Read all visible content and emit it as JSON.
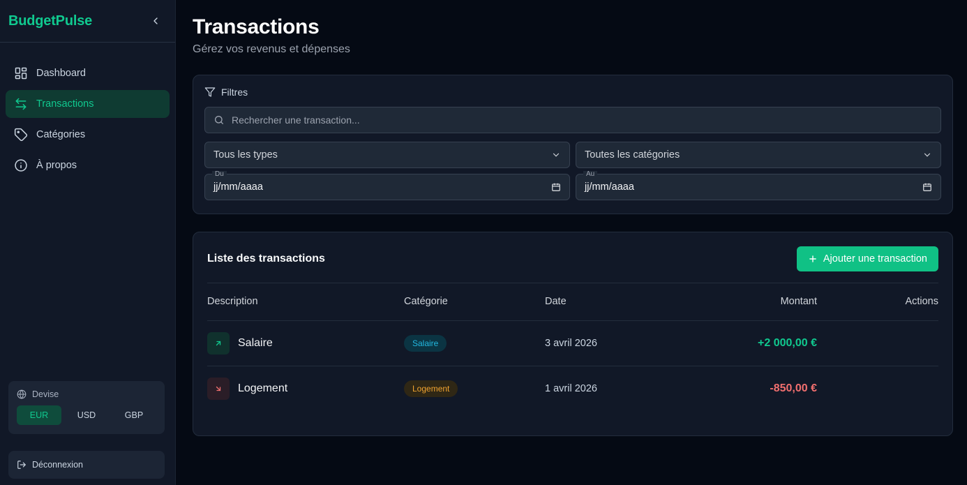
{
  "sidebar": {
    "brand": "BudgetPulse",
    "nav": [
      {
        "label": "Dashboard",
        "icon": "dashboard-grid-icon"
      },
      {
        "label": "Transactions",
        "icon": "arrows-swap-icon",
        "active": true
      },
      {
        "label": "Catégories",
        "icon": "tag-icon"
      },
      {
        "label": "À propos",
        "icon": "info-icon"
      }
    ],
    "currency": {
      "label": "Devise",
      "options": [
        "EUR",
        "USD",
        "GBP"
      ],
      "selected": "EUR"
    },
    "logout_label": "Déconnexion"
  },
  "page": {
    "title": "Transactions",
    "subtitle": "Gérez vos revenus et dépenses"
  },
  "filters": {
    "title": "Filtres",
    "search_placeholder": "Rechercher une transaction...",
    "type_select": "Tous les types",
    "category_select": "Toutes les catégories",
    "from_label": "Du",
    "from_value": "jj/mm/aaaa",
    "to_label": "Au",
    "to_value": "jj/mm/aaaa"
  },
  "list": {
    "title": "Liste des transactions",
    "add_label": "Ajouter une transaction",
    "columns": [
      "Description",
      "Catégorie",
      "Date",
      "Montant",
      "Actions"
    ],
    "rows": [
      {
        "description": "Salaire",
        "category": "Salaire",
        "date": "3 avril 2026",
        "amount": "+2 000,00 €",
        "type": "income"
      },
      {
        "description": "Logement",
        "category": "Logement",
        "date": "1 avril 2026",
        "amount": "-850,00 €",
        "type": "expense"
      }
    ]
  },
  "colors": {
    "accent": "#10c98f",
    "expense": "#f16f6f",
    "background": "#050a14",
    "card": "#111827"
  }
}
